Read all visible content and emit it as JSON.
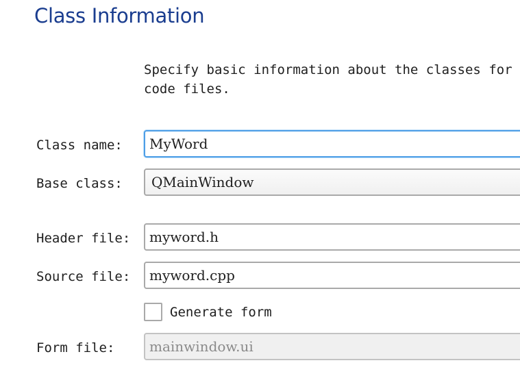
{
  "header": {
    "title": "Class Information"
  },
  "description": "Specify basic information about the classes for which you want to generate skeleton source\ncode files.",
  "form": {
    "class_name": {
      "label": "Class name:",
      "value": "MyWord"
    },
    "base_class": {
      "label": "Base class:",
      "value": "QMainWindow"
    },
    "header_file": {
      "label": "Header file:",
      "value": "myword.h"
    },
    "source_file": {
      "label": "Source file:",
      "value": "myword.cpp"
    },
    "generate_form": {
      "label": "Generate form",
      "checked": false
    },
    "form_file": {
      "label": "Form file:",
      "value": "mainwindow.ui"
    }
  },
  "colors": {
    "title": "#1a3d8f",
    "focus_border": "#4d9ee6",
    "field_border": "#a9a9a9",
    "disabled_text": "#8a8a8a"
  }
}
